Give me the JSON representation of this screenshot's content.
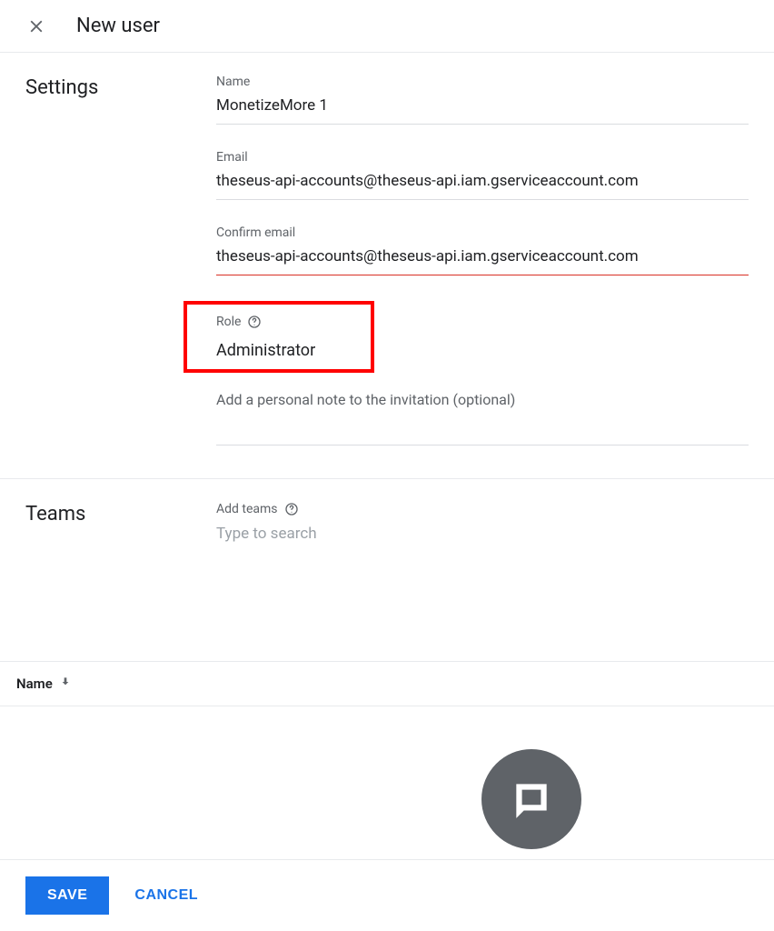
{
  "header": {
    "title": "New user"
  },
  "settings": {
    "section_label": "Settings",
    "name_label": "Name",
    "name_value": "MonetizeMore 1",
    "email_label": "Email",
    "email_value": "theseus-api-accounts@theseus-api.iam.gserviceaccount.com",
    "confirm_email_label": "Confirm email",
    "confirm_email_value": "theseus-api-accounts@theseus-api.iam.gserviceaccount.com",
    "role_label": "Role",
    "role_value": "Administrator",
    "note_placeholder": "Add a personal note to the invitation (optional)"
  },
  "teams": {
    "section_label": "Teams",
    "add_teams_label": "Add teams",
    "search_placeholder": "Type to search"
  },
  "table": {
    "column_name": "Name"
  },
  "footer": {
    "save_label": "SAVE",
    "cancel_label": "CANCEL"
  },
  "icons": {
    "close": "close-icon",
    "help": "help-icon",
    "sort_down": "arrow-down-icon",
    "chat": "chat-icon"
  }
}
